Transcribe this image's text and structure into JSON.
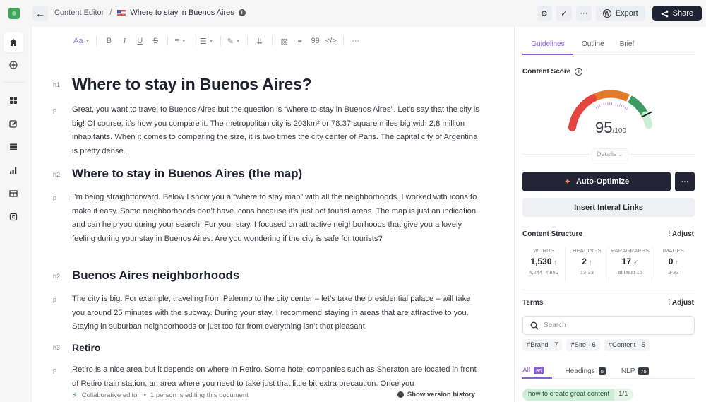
{
  "topbar": {
    "breadcrumb_root": "Content Editor",
    "breadcrumb_separator": "/",
    "document_title": "Where to stay in Buenos Aires",
    "icons": {
      "back": "arrow-left-icon",
      "settings": "gear-icon",
      "check": "check-icon",
      "more": "more-horizontal-icon",
      "wordpress": "wordpress-icon",
      "share": "share-icon",
      "flag": "us-flag-icon",
      "info": "info-icon"
    },
    "export_label": "Export",
    "share_label": "Share"
  },
  "sidebar": {
    "items": [
      {
        "name": "home",
        "icon": "home-icon",
        "active": true
      },
      {
        "name": "globe",
        "icon": "globe-icon",
        "active": false
      },
      {
        "name": "dashboard",
        "icon": "grid-icon",
        "active": false
      },
      {
        "name": "editor",
        "icon": "edit-icon",
        "active": false
      },
      {
        "name": "list",
        "icon": "list-icon",
        "active": false
      },
      {
        "name": "analytics",
        "icon": "bar-chart-icon",
        "active": false
      },
      {
        "name": "table",
        "icon": "table-icon",
        "active": false
      },
      {
        "name": "audit",
        "icon": "audit-icon",
        "active": false
      }
    ]
  },
  "toolbar": {
    "text_style": "Aa",
    "bold": "B",
    "italic": "I",
    "underline": "U",
    "strike": "S",
    "quote": "99",
    "code": "</>",
    "more": "···"
  },
  "document": {
    "blocks": [
      {
        "tag": "h1",
        "text": "Where to stay in Buenos Aires?"
      },
      {
        "tag": "p",
        "text": "Great, you want to travel to Buenos Aires but the question is “where to stay in Buenos Aires”. Let’s say that the city is big! Of course, it’s how you compare it. The metropolitan city is 203km² or 78.37 square miles big with 2,8 million inhabitants. When it comes to comparing the size, it is two times the city center of Paris. The capital city of Argentina is pretty dense."
      },
      {
        "tag": "h2",
        "text": "Where to stay in Buenos Aires (the map)"
      },
      {
        "tag": "p",
        "text": "I’m being straightforward. Below I show you a “where to stay map” with all the neighborhoods. I worked with icons to make it easy. Some neighborhoods don’t have icons because it’s just not tourist areas. The map is just an indication and can help you during your search. For your stay, I focused on attractive neighborhoods that give you a lovely feeling during your stay in Buenos Aires. Are you wondering if the city is safe for tourists?"
      },
      {
        "tag": "h2",
        "text": "Buenos Aires neighborhoods"
      },
      {
        "tag": "p",
        "text": "The city is big. For example, traveling from Palermo to the city center – let’s take the presidential palace – will take you around 25 minutes with the subway. During your stay, I recommend staying in areas that are attractive to you. Staying in suburban neighborhoods or just too far from everything isn’t that pleasant."
      },
      {
        "tag": "h3",
        "text": "Retiro"
      },
      {
        "tag": "p",
        "text": "Retiro is a nice area but it depends on where in Retiro. Some hotel companies such as Sheraton are located in front of Retiro train station, an area where you need to take just that little bit extra precaution. Once you"
      }
    ]
  },
  "footer": {
    "collab": "Collaborative editor",
    "editing": "1 person is editing this document",
    "history": "Show version history"
  },
  "panel": {
    "tabs": [
      "Guidelines",
      "Outline",
      "Brief"
    ],
    "active_tab": "Guidelines",
    "content_score_title": "Content Score",
    "score": "95",
    "score_max": "/100",
    "score_value": 95,
    "details_label": "Details",
    "auto_optimize_label": "Auto-Optimize",
    "insert_links_label": "Insert Interal Links",
    "structure_title": "Content Structure",
    "adjust_label": "Adjust",
    "stats": [
      {
        "label": "WORDS",
        "value": "1,530",
        "status": "up",
        "range": "4,244–4,880"
      },
      {
        "label": "HEADINGS",
        "value": "2",
        "status": "up",
        "range": "13-33"
      },
      {
        "label": "PARAGRAPHS",
        "value": "17",
        "status": "ok",
        "range": "at least 15"
      },
      {
        "label": "IMAGES",
        "value": "0",
        "status": "up",
        "range": "3-33"
      }
    ],
    "terms_title": "Terms",
    "search_placeholder": "Search",
    "chips": [
      "#Brand - 7",
      "#Site - 6",
      "#Content - 5"
    ],
    "term_tabs": [
      {
        "label": "All",
        "count": "80",
        "active": true
      },
      {
        "label": "Headings",
        "count": "5",
        "active": false
      },
      {
        "label": "NLP",
        "count": "75",
        "active": false
      }
    ],
    "terms": [
      {
        "term": "how to create great content",
        "count": "1/1"
      }
    ],
    "colors": {
      "accent": "#8a5cd8",
      "gauge_red": "#e5453f",
      "gauge_orange": "#e27a2b",
      "gauge_green": "#3b9b63",
      "dark_button": "#232536"
    }
  }
}
